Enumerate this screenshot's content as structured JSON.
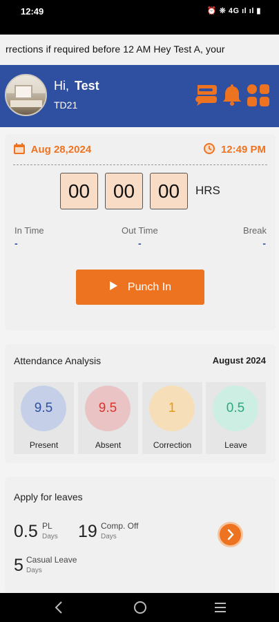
{
  "status_bar": {
    "time": "12:49",
    "icons_text": "⏰ ❊ 4G ıl ıl ▮"
  },
  "ticker": {
    "text": "rrections if required before   12 AM        Hey    Test A, your"
  },
  "header": {
    "greeting": "Hi,",
    "name": "Test",
    "employee_code": "TD21",
    "color": "#2f4fa1"
  },
  "punch_card": {
    "date": "Aug 28,2024",
    "time": "12:49 PM",
    "hours": "00",
    "minutes": "00",
    "seconds": "00",
    "unit": "HRS",
    "in_time_label": "In Time",
    "in_time_value": "-",
    "out_time_label": "Out Time",
    "out_time_value": "-",
    "break_label": "Break",
    "break_value": "-",
    "punch_button_label": "Punch In",
    "accent_color": "#ee7320"
  },
  "attendance": {
    "title": "Attendance Analysis",
    "month": "August 2024",
    "stats": [
      {
        "value": "9.5",
        "label": "Present",
        "color": "#2f4fa1"
      },
      {
        "value": "9.5",
        "label": "Absent",
        "color": "#d8342d"
      },
      {
        "value": "1",
        "label": "Correction",
        "color": "#e79a1a"
      },
      {
        "value": "0.5",
        "label": "Leave",
        "color": "#2ea77f"
      }
    ]
  },
  "leaves": {
    "title": "Apply for leaves",
    "items": [
      {
        "value": "0.5",
        "name": "PL",
        "unit": "Days"
      },
      {
        "value": "19",
        "name": "Comp. Off",
        "unit": "Days"
      },
      {
        "value": "5",
        "name": "Casual Leave",
        "unit": "Days"
      }
    ]
  }
}
